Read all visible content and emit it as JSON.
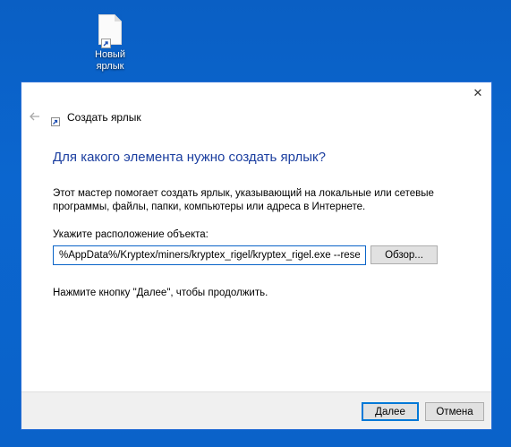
{
  "desktop": {
    "icon_label": "Новый ярлык",
    "icon_name": "shortcut-file-icon"
  },
  "dialog": {
    "close_glyph": "✕",
    "title": "Создать ярлык",
    "heading": "Для какого элемента нужно создать ярлык?",
    "description": "Этот мастер помогает создать ярлык, указывающий на локальные или сетевые программы, файлы, папки, компьютеры или адреса в Интернете.",
    "location_label": "Укажите расположение объекта:",
    "location_value": "%AppData%/Kryptex/miners/kryptex_rigel/kryptex_rigel.exe --reset-oc",
    "browse_label": "Обзор...",
    "hint": "Нажмите кнопку \"Далее\", чтобы продолжить.",
    "next_label": "Далее",
    "cancel_label": "Отмена"
  },
  "colors": {
    "desktop_bg": "#0a62c9",
    "heading": "#1c3fa0",
    "accent": "#0078d7",
    "footer_bg": "#f0f0f0"
  }
}
